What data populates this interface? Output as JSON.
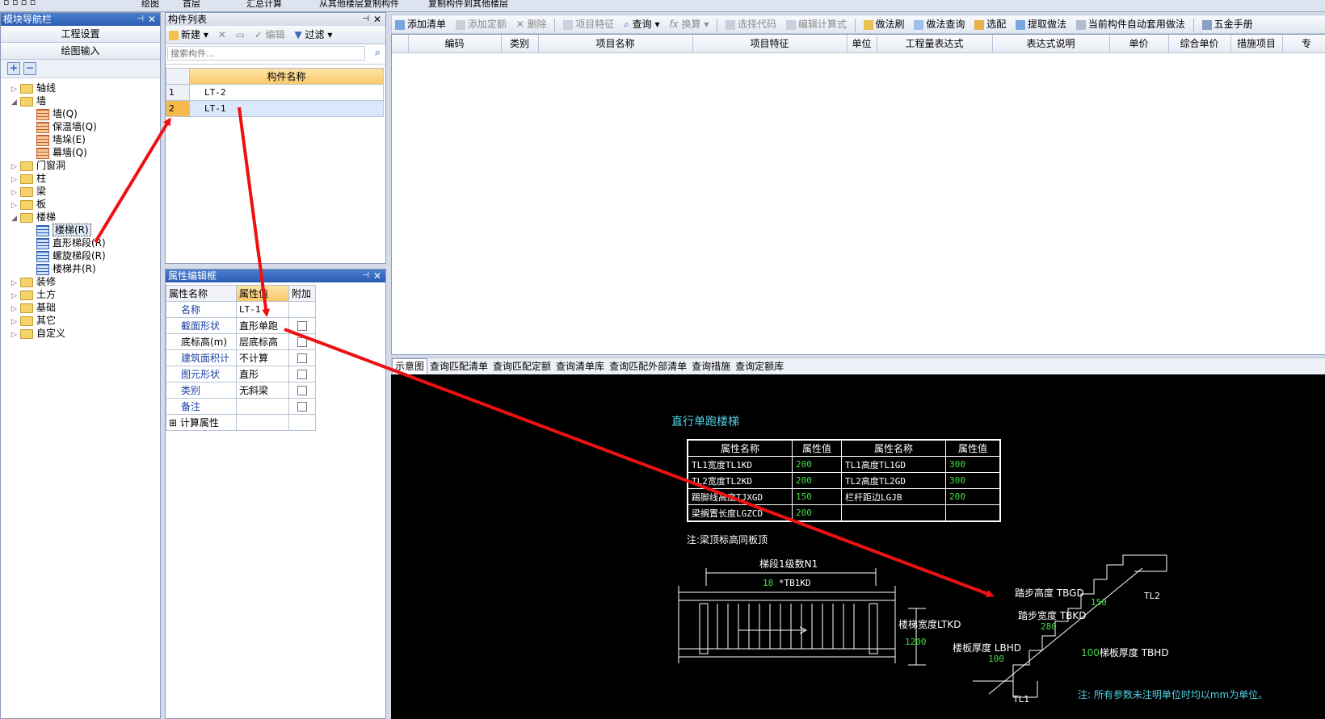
{
  "topbar": {
    "items": [
      "绘图",
      "首层",
      "汇总计算",
      "从其他楼层复制构件",
      "复制构件到其他楼层"
    ]
  },
  "module_nav": {
    "title": "模块导航栏",
    "buttons": [
      "工程设置",
      "绘图输入"
    ],
    "tree": [
      {
        "label": "轴线",
        "level": 0,
        "expanded": false
      },
      {
        "label": "墙",
        "level": 0,
        "expanded": true
      },
      {
        "label": "墙(Q)",
        "level": 1
      },
      {
        "label": "保温墙(Q)",
        "level": 1
      },
      {
        "label": "墙垛(E)",
        "level": 1
      },
      {
        "label": "幕墙(Q)",
        "level": 1
      },
      {
        "label": "门窗洞",
        "level": 0,
        "expanded": false
      },
      {
        "label": "柱",
        "level": 0,
        "expanded": false
      },
      {
        "label": "梁",
        "level": 0,
        "expanded": false
      },
      {
        "label": "板",
        "level": 0,
        "expanded": false
      },
      {
        "label": "楼梯",
        "level": 0,
        "expanded": true
      },
      {
        "label": "楼梯(R)",
        "level": 1,
        "selected": true
      },
      {
        "label": "直形梯段(R)",
        "level": 1
      },
      {
        "label": "螺旋梯段(R)",
        "level": 1
      },
      {
        "label": "楼梯井(R)",
        "level": 1
      },
      {
        "label": "装修",
        "level": 0,
        "expanded": false
      },
      {
        "label": "土方",
        "level": 0,
        "expanded": false
      },
      {
        "label": "基础",
        "level": 0,
        "expanded": false
      },
      {
        "label": "其它",
        "level": 0,
        "expanded": false
      },
      {
        "label": "自定义",
        "level": 0,
        "expanded": false
      }
    ]
  },
  "component_list": {
    "title": "构件列表",
    "toolbar": {
      "new": "新建",
      "edit": "编辑",
      "filter": "过滤"
    },
    "search_placeholder": "搜索构件...",
    "column": "构件名称",
    "rows": [
      {
        "index": "1",
        "name": "LT-2"
      },
      {
        "index": "2",
        "name": "LT-1"
      }
    ]
  },
  "property_editor": {
    "title": "属性编辑框",
    "headers": [
      "属性名称",
      "属性值",
      "附加"
    ],
    "rows": [
      {
        "name": "名称",
        "value": "LT-1",
        "blue": true,
        "check": false
      },
      {
        "name": "截面形状",
        "value": "直形单跑",
        "blue": true,
        "check": true
      },
      {
        "name": "底标高(m)",
        "value": "层底标高",
        "blue": false,
        "check": true
      },
      {
        "name": "建筑面积计",
        "value": "不计算",
        "blue": true,
        "check": true
      },
      {
        "name": "图元形状",
        "value": "直形",
        "blue": true,
        "check": true
      },
      {
        "name": "类别",
        "value": "无斜梁",
        "blue": true,
        "check": true
      },
      {
        "name": "备注",
        "value": "",
        "blue": true,
        "check": true
      },
      {
        "name": "计算属性",
        "value": "",
        "blue": false,
        "check": false,
        "expander": "+"
      }
    ]
  },
  "main_toolbar": {
    "items": [
      "添加清单",
      "添加定额",
      "删除",
      "项目特征",
      "查询",
      "换算",
      "选择代码",
      "编辑计算式",
      "做法刷",
      "做法查询",
      "选配",
      "提取做法",
      "当前构件自动套用做法",
      "五金手册"
    ]
  },
  "bill_table": {
    "headers": [
      "编码",
      "类别",
      "项目名称",
      "项目特征",
      "单位",
      "工程量表达式",
      "表达式说明",
      "单价",
      "综合单价",
      "措施项目",
      "专"
    ]
  },
  "bottom_tabs": [
    "示意图",
    "查询匹配清单",
    "查询匹配定额",
    "查询清单库",
    "查询匹配外部清单",
    "查询措施",
    "查询定额库"
  ],
  "diagram": {
    "title": "直行单跑楼梯",
    "param_table": {
      "headers": [
        "属性名称",
        "属性值",
        "属性名称",
        "属性值"
      ],
      "rows": [
        [
          "TL1宽度TL1KD",
          "200",
          "TL1高度TL1GD",
          "300"
        ],
        [
          "TL2宽度TL2KD",
          "200",
          "TL2高度TL2GD",
          "300"
        ],
        [
          "踢脚线高度TJXGD",
          "150",
          "栏杆距边LGJB",
          "200"
        ],
        [
          "梁搁置长度LGZCD",
          "200",
          "",
          ""
        ]
      ]
    },
    "note1": "注:梁顶标高同板顶",
    "plan": {
      "label_top": "梯段1级数N1",
      "formula_num": "18",
      "formula_rest": "*TB1KD",
      "width_label": "楼梯宽度LTKD",
      "width_value": "1200"
    },
    "section": {
      "step_height": "踏步高度 TBGD",
      "step_height_val": "150",
      "step_width": "踏步宽度 TBKD",
      "step_width_val": "280",
      "slab_label": "楼板厚度 LBHD",
      "slab_val": "100",
      "stair_slab_val": "100",
      "stair_slab_label": "梯板厚度 TBHD",
      "tl1": "TL1",
      "tl2": "TL2"
    },
    "note2": "注: 所有参数未注明单位时均以mm为单位。"
  },
  "colors": {
    "accent": "#2a5cb0",
    "arrow": "#ee1111",
    "cad_green": "#44dd44",
    "cad_cyan": "#4fd3e6"
  }
}
